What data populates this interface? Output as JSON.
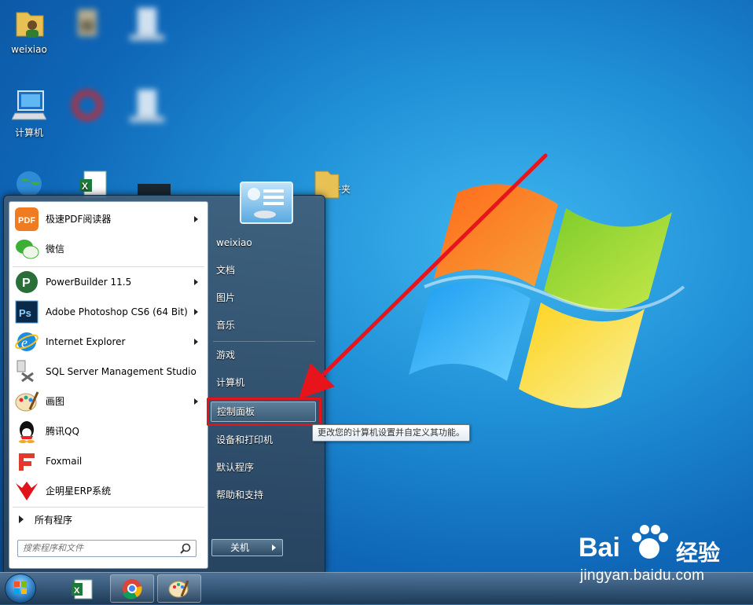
{
  "desktop": {
    "icons": [
      {
        "label": "weixiao",
        "icon": "user-folder-icon"
      },
      {
        "label": "计算机",
        "icon": "computer-icon"
      },
      {
        "label": "文件夹",
        "icon": "folder-icon"
      }
    ]
  },
  "start_menu": {
    "pinned": [
      {
        "label": "极速PDF阅读器",
        "icon": "pdf-reader-icon",
        "submenu": true
      },
      {
        "label": "微信",
        "icon": "wechat-icon",
        "submenu": false
      }
    ],
    "recent": [
      {
        "label": "PowerBuilder 11.5",
        "icon": "powerbuilder-icon",
        "submenu": true
      },
      {
        "label": "Adobe Photoshop CS6 (64 Bit)",
        "icon": "photoshop-icon",
        "submenu": true
      },
      {
        "label": "Internet Explorer",
        "icon": "ie-icon",
        "submenu": true
      },
      {
        "label": "SQL Server Management Studio",
        "icon": "sql-server-icon",
        "submenu": false
      },
      {
        "label": "画图",
        "icon": "paint-icon",
        "submenu": true
      },
      {
        "label": "腾讯QQ",
        "icon": "qq-icon",
        "submenu": false
      },
      {
        "label": "Foxmail",
        "icon": "foxmail-icon",
        "submenu": false
      },
      {
        "label": "企明星ERP系统",
        "icon": "erp-icon",
        "submenu": false
      }
    ],
    "all_programs": "所有程序",
    "search_placeholder": "搜索程序和文件",
    "right_items": [
      "weixiao",
      "文档",
      "图片",
      "音乐",
      "游戏",
      "计算机",
      "控制面板",
      "设备和打印机",
      "默认程序",
      "帮助和支持"
    ],
    "highlighted": "控制面板",
    "shutdown_label": "关机",
    "tooltip": "更改您的计算机设置并自定义其功能。"
  },
  "taskbar": {
    "items": [
      "start-orb-icon",
      "excel-icon",
      "chrome-icon",
      "paint-icon"
    ]
  },
  "watermark": {
    "logo": "Bai",
    "cn": "经验",
    "url": "jingyan.baidu.com"
  },
  "colors": {
    "highlight_border": "#e0141b",
    "arrow": "#e8141b"
  }
}
